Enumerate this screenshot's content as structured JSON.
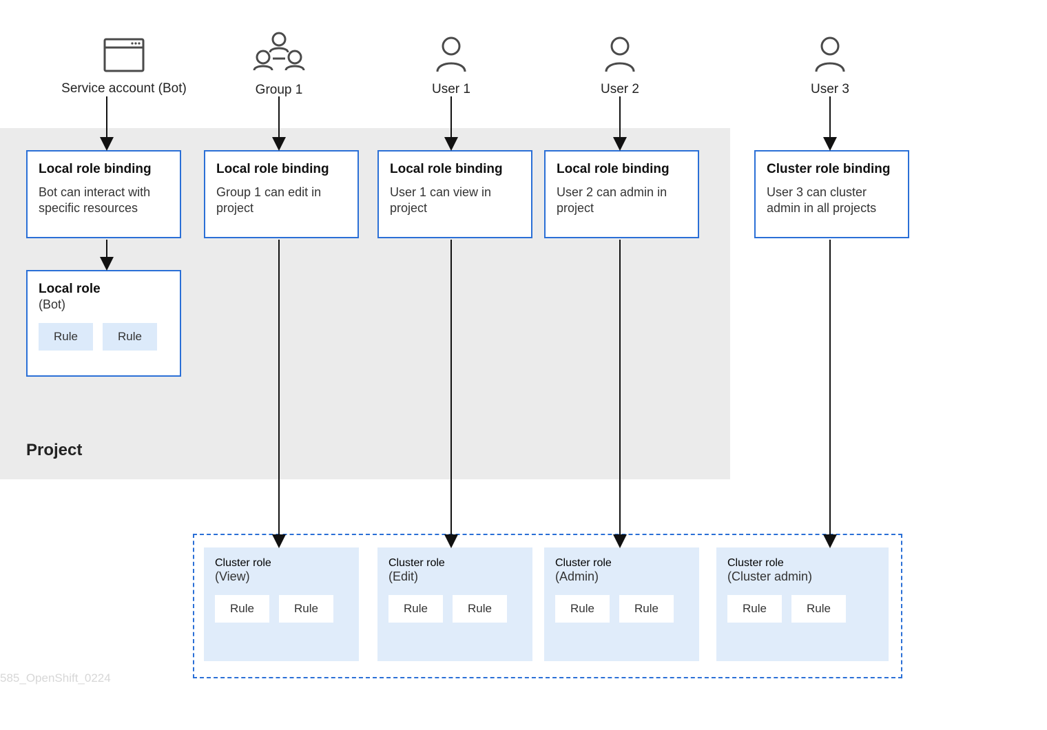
{
  "entities": {
    "service_account": {
      "label": "Service account (Bot)"
    },
    "group1": {
      "label": "Group 1"
    },
    "user1": {
      "label": "User 1"
    },
    "user2": {
      "label": "User 2"
    },
    "user3": {
      "label": "User 3"
    }
  },
  "bindings": {
    "bot": {
      "title": "Local role binding",
      "desc": "Bot can interact with specific resources"
    },
    "group1": {
      "title": "Local role binding",
      "desc": "Group 1 can edit in project"
    },
    "user1": {
      "title": "Local role binding",
      "desc": "User 1 can view in project"
    },
    "user2": {
      "title": "Local role binding",
      "desc": "User 2 can admin in project"
    },
    "user3": {
      "title": "Cluster role binding",
      "desc": "User 3 can cluster admin in all projects"
    }
  },
  "local_role": {
    "title": "Local role",
    "subtitle": "(Bot)",
    "rule1": "Rule",
    "rule2": "Rule"
  },
  "cluster_roles": {
    "view": {
      "title": "Cluster role",
      "subtitle": "(View)",
      "rule1": "Rule",
      "rule2": "Rule"
    },
    "edit": {
      "title": "Cluster role",
      "subtitle": "(Edit)",
      "rule1": "Rule",
      "rule2": "Rule"
    },
    "admin": {
      "title": "Cluster role",
      "subtitle": "(Admin)",
      "rule1": "Rule",
      "rule2": "Rule"
    },
    "cadmin": {
      "title": "Cluster role",
      "subtitle": "(Cluster admin)",
      "rule1": "Rule",
      "rule2": "Rule"
    }
  },
  "project_label": "Project",
  "watermark": "585_OpenShift_0224"
}
